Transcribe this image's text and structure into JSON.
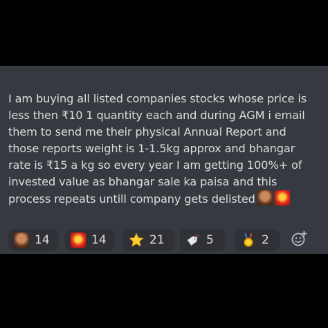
{
  "message": {
    "lines": [
      "I am buying all listed companies stocks whose price is",
      "less then ₹10 1 quantity each and during AGM i email",
      "them to send me their physical Annual Report and",
      "those reports weight is 1-1.5kg approx and bhangar",
      "rate is ₹15 a kg so every year I am getting 100%+ of",
      "invested value as bhangar sale ka paisa and this",
      "process  repeats untill company gets delisted"
    ],
    "trailing_emojis": [
      "custom-face-emoji",
      "angry-red-face-emoji"
    ]
  },
  "reactions": [
    {
      "icon": "custom-face-emoji",
      "count": "14"
    },
    {
      "icon": "angry-red-face-emoji",
      "count": "14"
    },
    {
      "icon": "star-emoji",
      "count": "21"
    },
    {
      "icon": "price-tag-emoji",
      "count": "5"
    },
    {
      "icon": "medal-emoji",
      "count": "2"
    }
  ],
  "add_reaction": {
    "icon": "add-reaction-icon"
  },
  "colors": {
    "background": "#000000",
    "card": "#36393f",
    "reaction_chip": "#2f3136",
    "text": "#dcddde"
  }
}
